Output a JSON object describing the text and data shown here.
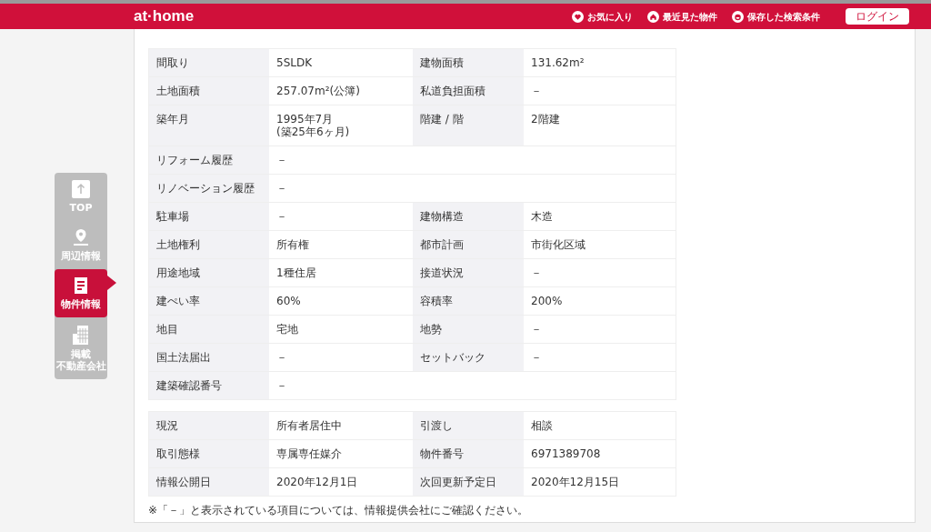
{
  "header": {
    "logo": "at·home",
    "links": [
      {
        "kind": "heart",
        "label": "お気に入り"
      },
      {
        "kind": "house",
        "label": "最近見た物件"
      },
      {
        "kind": "saved",
        "label": "保存した検索条件"
      }
    ],
    "login_button": "ログイン"
  },
  "side_nav": [
    {
      "kind": "top",
      "lines": [
        "TOP"
      ],
      "selected": false
    },
    {
      "kind": "pin",
      "lines": [
        "周辺情報"
      ],
      "selected": false
    },
    {
      "kind": "doc",
      "lines": [
        "物件情報"
      ],
      "selected": true
    },
    {
      "kind": "building",
      "lines": [
        "掲載",
        "不動産会社"
      ],
      "selected": false
    }
  ],
  "details_table": [
    {
      "kind": "pair",
      "cells": [
        "間取り",
        "5SLDK",
        "建物面積",
        "131.62m²"
      ]
    },
    {
      "kind": "pair",
      "cells": [
        "土地面積",
        "257.07m²(公簿)",
        "私道負担面積",
        "－"
      ]
    },
    {
      "kind": "pair",
      "cells": [
        "築年月",
        "1995年7月\n(築25年6ヶ月)",
        "階建 / 階",
        "2階建"
      ]
    },
    {
      "kind": "single",
      "label": "リフォーム履歴",
      "value": "－"
    },
    {
      "kind": "single",
      "label": "リノベーション履歴",
      "value": "－"
    },
    {
      "kind": "pair",
      "cells": [
        "駐車場",
        "－",
        "建物構造",
        "木造"
      ]
    },
    {
      "kind": "pair",
      "cells": [
        "土地権利",
        "所有権",
        "都市計画",
        "市街化区域"
      ]
    },
    {
      "kind": "pair",
      "cells": [
        "用途地域",
        "1種住居",
        "接道状況",
        "－"
      ]
    },
    {
      "kind": "pair",
      "cells": [
        "建ぺい率",
        "60%",
        "容積率",
        "200%"
      ]
    },
    {
      "kind": "pair",
      "cells": [
        "地目",
        "宅地",
        "地勢",
        "－"
      ]
    },
    {
      "kind": "pair",
      "cells": [
        "国土法届出",
        "－",
        "セットバック",
        "－"
      ]
    },
    {
      "kind": "single",
      "label": "建築確認番号",
      "value": "－"
    }
  ],
  "status_table": [
    {
      "kind": "pair",
      "cells": [
        "現況",
        "所有者居住中",
        "引渡し",
        "相談"
      ]
    },
    {
      "kind": "pair",
      "cells": [
        "取引態様",
        "専属専任媒介",
        "物件番号",
        "6971389708"
      ]
    },
    {
      "kind": "pair",
      "cells": [
        "情報公開日",
        "2020年12月1日",
        "次回更新予定日",
        "2020年12月15日"
      ]
    }
  ],
  "footnote": "※「－」と表示されている項目については、情報提供会社にご確認ください。"
}
